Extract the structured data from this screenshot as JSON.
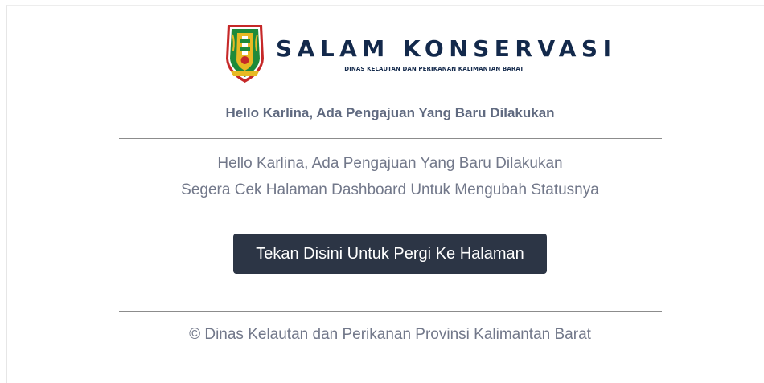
{
  "brand": {
    "title": "SALAM KONSERVASI",
    "subtitle": "DINAS KELAUTAN DAN PERIKANAN KALIMANTAN BARAT"
  },
  "email": {
    "heading": "Hello Karlina, Ada Pengajuan Yang Baru Dilakukan",
    "message_line_1": "Hello Karlina, Ada Pengajuan Yang Baru Dilakukan",
    "message_line_2": "Segera Cek Halaman Dashboard Untuk Mengubah Statusnya",
    "button_label": "Tekan Disini Untuk Pergi Ke Halaman",
    "footer": "© Dinas Kelautan dan Perikanan Provinsi Kalimantan Barat"
  },
  "colors": {
    "brand_navy": "#13294b",
    "button_bg": "#2c3545",
    "emblem_green": "#1e8a3a",
    "emblem_red": "#c62828",
    "emblem_gold": "#e8b923"
  },
  "icons": {
    "logo": "kalimantan-barat-emblem-icon"
  }
}
